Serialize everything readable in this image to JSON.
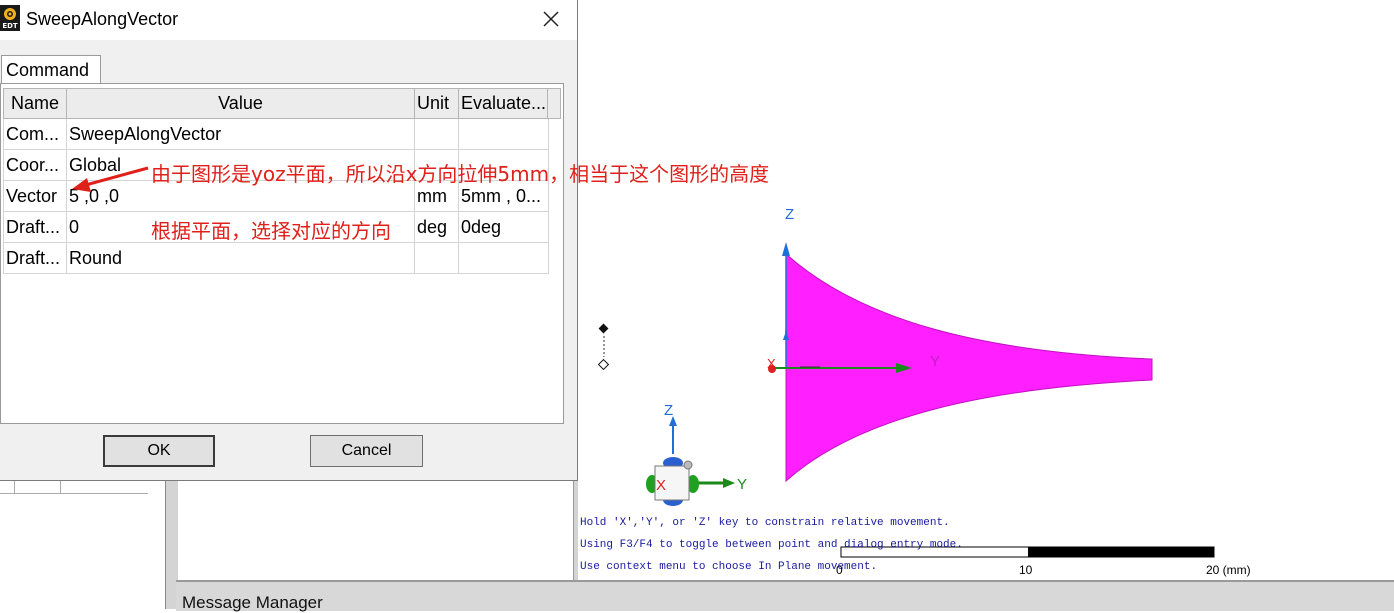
{
  "dialog": {
    "title": "SweepAlongVector",
    "tab_label": "Command",
    "columns": [
      "Name",
      "Value",
      "Unit",
      "Evaluate..."
    ],
    "rows": [
      {
        "name": "Com...",
        "value": "SweepAlongVector",
        "unit": "",
        "evaluated": ""
      },
      {
        "name": "Coor...",
        "value": "Global",
        "unit": "",
        "evaluated": ""
      },
      {
        "name": "Vector",
        "value": "5 ,0 ,0",
        "unit": "mm",
        "evaluated": "5mm , 0..."
      },
      {
        "name": "Draft...",
        "value": "0",
        "unit": "deg",
        "evaluated": "0deg"
      },
      {
        "name": "Draft...",
        "value": "Round",
        "unit": "",
        "evaluated": ""
      }
    ],
    "ok_label": "OK",
    "cancel_label": "Cancel",
    "app_icon_text": "EDT"
  },
  "annotations": {
    "note_1": "由于图形是yoz平面，所以沿x方向拉伸5mm，相当于这个图形的高度",
    "note_2": "根据平面，选择对应的方向",
    "color": "#e0201a"
  },
  "viewport": {
    "hints": [
      "Hold 'X','Y', or 'Z' key to constrain relative movement.",
      "Using F3/F4 to toggle between point and dialog entry mode.",
      "Use context menu to choose In Plane movement."
    ],
    "ruler": {
      "tick_0": "0",
      "tick_10": "10",
      "tick_20": "20 (mm)"
    },
    "axis_labels": {
      "model_z": "Z",
      "model_x": "X",
      "model_y": "Y",
      "triad_z": "Z",
      "triad_x": "X",
      "triad_y": "Y"
    },
    "shape_color": "#ff1fff"
  },
  "message_manager": {
    "label": "Message Manager"
  }
}
